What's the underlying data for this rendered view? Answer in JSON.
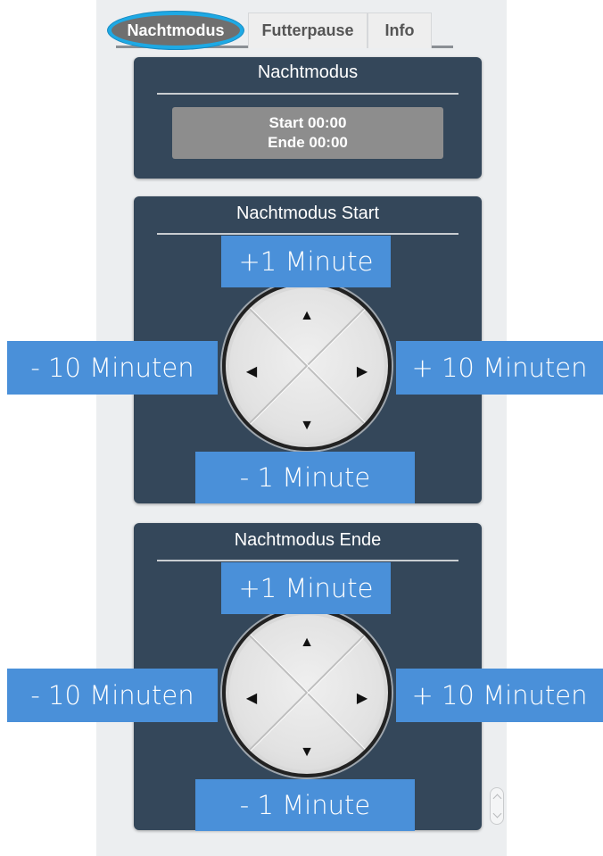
{
  "tabs": [
    {
      "label": "Nachtmodus",
      "active": true
    },
    {
      "label": "Futterpause",
      "active": false
    },
    {
      "label": "Info",
      "active": false
    }
  ],
  "status_panel": {
    "title": "Nachtmodus",
    "start_text": "Start 00:00",
    "end_text": "Ende 00:00"
  },
  "start_panel": {
    "title": "Nachtmodus Start",
    "up_label": "+1 Minute",
    "down_label": "- 1 Minute",
    "left_label": "- 10 Minuten",
    "right_label": "+ 10 Minuten"
  },
  "end_panel": {
    "title": "Nachtmodus Ende",
    "up_label": "+1 Minute",
    "down_label": "- 1 Minute",
    "left_label": "- 10 Minuten",
    "right_label": "+ 10 Minuten"
  },
  "icons": {
    "up": "▲",
    "down": "▼",
    "left": "◀",
    "right": "▶"
  },
  "colors": {
    "panel": "#34475a",
    "label_blue": "#4a90d9",
    "tab_highlight": "#1ea9e4"
  }
}
